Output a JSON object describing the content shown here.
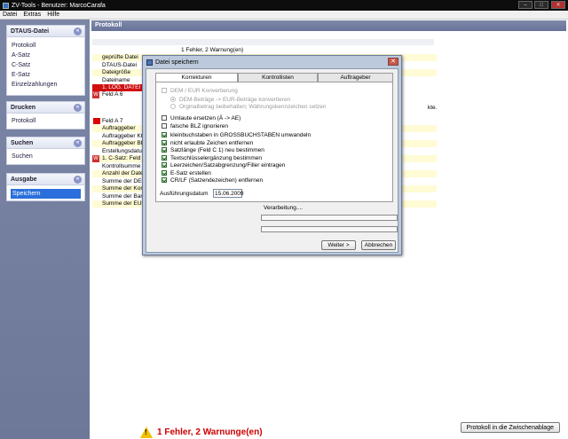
{
  "window": {
    "title": "ZV-Tools - Benutzer: MarcoCarafa",
    "min": "–",
    "max": "□",
    "close": "✕"
  },
  "menu": [
    "Datei",
    "Extras",
    "Hilfe"
  ],
  "sidebar": {
    "dtaus": {
      "title": "DTAUS-Datei",
      "items": [
        "Protokoll",
        "A-Satz",
        "C-Satz",
        "E-Satz",
        "Einzelzahlungen"
      ]
    },
    "drucken": {
      "title": "Drucken",
      "items": [
        "Protokoll"
      ]
    },
    "suchen": {
      "title": "Suchen",
      "items": [
        "Suchen"
      ]
    },
    "ausgabe": {
      "title": "Ausgabe",
      "items": [
        "Speichern"
      ]
    },
    "collapse_glyph": "«"
  },
  "main": {
    "header": "Protokoll",
    "summary_line": "1 Fehler, 2 Warnung(en)",
    "rows": [
      "geprüfte Datei",
      "DTAUS-Datei",
      "Dateigröße",
      "Dateiname",
      "1. LOG. DATEI",
      "Feld A 6",
      "Feld A 7",
      "Auftraggeber",
      "Auftraggeber Kt",
      "Auftraggeber BL",
      "Erstellungsdatu",
      "1. C-Satz: Feld",
      "Kontrollsumme",
      "Anzahl der Date",
      "Summe der DEM",
      "Summe der Kon",
      "Summe der Ban",
      "Summe der EUR"
    ],
    "right_fragment": "kte.",
    "w_glyph": "W",
    "status": "1 Fehler, 2 Warnunge(en)",
    "warn_glyph": "!",
    "clipboard_button": "Protokoll in die Zwischenablage"
  },
  "dialog": {
    "title": "Datei speichern",
    "close": "✕",
    "tabs": [
      "Korrekturen",
      "Kontrollisten",
      "Auftrageber"
    ],
    "dem_eur": "DEM / EUR Konvertierung",
    "radio1": "DEM-Beträge -> EUR-Beträge konvertieren",
    "radio2": "Orginalbetrag beibehalten; Währungskennzeichen setzen",
    "options": [
      {
        "label": "Umlaute ersetzen (Ä -> AE)",
        "checked": false
      },
      {
        "label": "falsche BLZ ignorieren",
        "checked": false
      },
      {
        "label": "kleinbuchstaben in GROSSBUCHSTABEN umwandeln",
        "checked": true
      },
      {
        "label": "nicht erlaubte Zeichen entfernen",
        "checked": true
      },
      {
        "label": "Satzlänge (Feld C 1)  neu bestimmen",
        "checked": true
      },
      {
        "label": "Textschlüsselergänzung bestimmen",
        "checked": true
      },
      {
        "label": "Leerzeichen/Satzabgrenzung/Filler eintragen",
        "checked": true
      },
      {
        "label": "E-Satz erstellen",
        "checked": true
      },
      {
        "label": "CR/LF (Satzendezeichen) entfernen",
        "checked": true
      }
    ],
    "date_label": "Ausführungsdatum",
    "date_value": "15.06.2009",
    "progress_label": "Verarbeitung....",
    "next_button": "Weiter >",
    "cancel_button": "Abbrechen"
  }
}
